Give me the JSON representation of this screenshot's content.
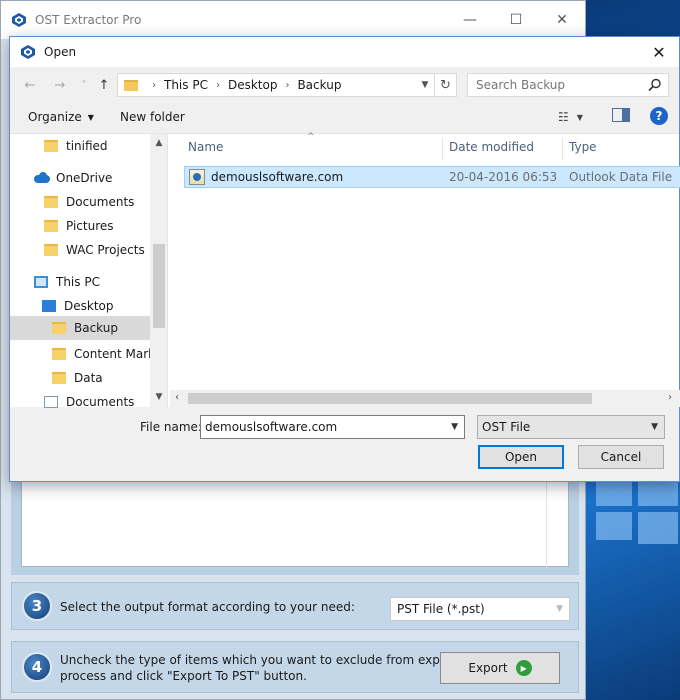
{
  "app": {
    "title": "OST Extractor Pro",
    "controls": {
      "minimize": "—",
      "maximize": "☐",
      "close": "✕"
    },
    "step3": {
      "number": "3",
      "text": "Select the output format according to your need:",
      "format_value": "PST File (*.pst)"
    },
    "step4": {
      "number": "4",
      "text_line1": "Uncheck the type of items which you want to exclude from export",
      "text_line2": "process and click \"Export To PST\" button.",
      "export_label": "Export"
    }
  },
  "dialog": {
    "title": "Open",
    "close": "✕",
    "nav": {
      "back": "←",
      "forward": "→",
      "recent": "˅",
      "up": "↑"
    },
    "breadcrumb": [
      "This PC",
      "Desktop",
      "Backup"
    ],
    "search_placeholder": "Search Backup",
    "toolbar": {
      "organize": "Organize",
      "new_folder": "New folder",
      "help": "?"
    },
    "nav_pane": [
      {
        "label": "tinified",
        "icon": "folder-icon"
      },
      {
        "label": "OneDrive",
        "icon": "onedrive-icon"
      },
      {
        "label": "Documents",
        "icon": "folder-icon"
      },
      {
        "label": "Pictures",
        "icon": "folder-icon"
      },
      {
        "label": "WAC Projects",
        "icon": "folder-icon"
      },
      {
        "label": "This PC",
        "icon": "this-pc-icon"
      },
      {
        "label": "Desktop",
        "icon": "desktop-icon"
      },
      {
        "label": "Backup",
        "icon": "folder-icon",
        "selected": true
      },
      {
        "label": "Content Marke",
        "icon": "folder-icon"
      },
      {
        "label": "Data",
        "icon": "folder-icon"
      },
      {
        "label": "Documents",
        "icon": "documents-icon"
      }
    ],
    "columns": {
      "name": "Name",
      "date": "Date modified",
      "type": "Type"
    },
    "files": [
      {
        "name": "demouslsoftware.com",
        "date": "20-04-2016 06:53",
        "type": "Outlook Data File"
      }
    ],
    "file_name_label": "File name:",
    "file_name_value": "demouslsoftware.com",
    "file_type": "OST File",
    "open_button": "Open",
    "cancel_button": "Cancel"
  },
  "colors": {
    "accent": "#0078d7",
    "selection": "#cce8ff",
    "folder": "#f6d36a",
    "app_panel": "#c4d7e8"
  }
}
